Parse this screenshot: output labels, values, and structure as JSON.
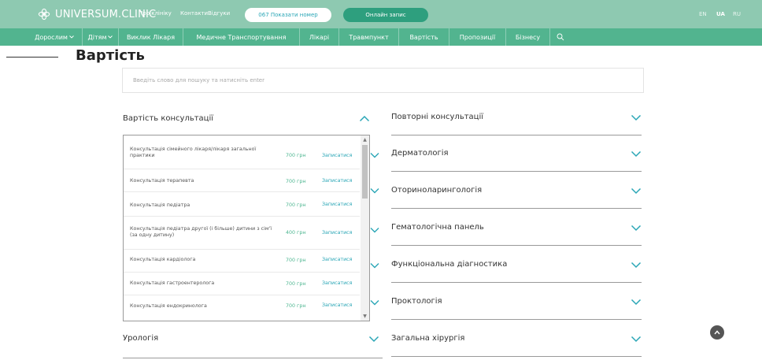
{
  "header": {
    "logo_text": "UNIVERSUM.CLINIC",
    "links": [
      "Про клініку",
      "Контакти",
      "Відгуки"
    ],
    "phone_button": "067 Показати номер",
    "online_button": "Онлайн запис",
    "languages": [
      "EN",
      "UA",
      "RU"
    ],
    "active_language": "UA"
  },
  "nav": {
    "items": [
      "Дорослим",
      "Дітям",
      "Виклик Лікаря",
      "Медичне Транспортування",
      "Лікарі",
      "Травмпункт",
      "Вартість",
      "Пропозиції",
      "Бізнесу"
    ]
  },
  "page": {
    "title": "Вартість",
    "search_placeholder": "Введіть слово для пошуку та натисніть enter"
  },
  "left_accordion": {
    "open_title": "Вартість консультації",
    "bottom_title": "Урологія",
    "rows": [
      {
        "name": "Консультація сімейного лікаря/лікаря загальної практики",
        "price": "700 грн",
        "action": "Записатися"
      },
      {
        "name": "Консультація терапевта",
        "price": "700 грн",
        "action": "Записатися"
      },
      {
        "name": "Консультація педіатра",
        "price": "700 грн",
        "action": "Записатися"
      },
      {
        "name": "Консультація педіатра другої (і більше) дитини з сім'ї (за одну дитину)",
        "price": "400 грн",
        "action": "Записатися"
      },
      {
        "name": "Консультація кардіолога",
        "price": "700 грн",
        "action": "Записатися"
      },
      {
        "name": "Консультація гастроентеролога",
        "price": "700 грн",
        "action": "Записатися"
      },
      {
        "name": "Консультація ендокринолога",
        "price": "700 грн",
        "action": "Записатися"
      }
    ]
  },
  "right_accordion": {
    "items": [
      "Повторні консультації",
      "Дерматологія",
      "Оториноларингологія",
      "Гематологічна панель",
      "Функціональна діагностика",
      "Проктологія",
      "Загальна хірургія"
    ]
  },
  "colors": {
    "topbar": "#8ec9b1",
    "nav": "#52b48f",
    "accent": "#2aa6b6",
    "price": "#4bb58f"
  }
}
